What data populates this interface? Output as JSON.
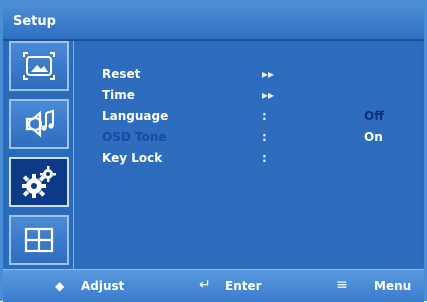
{
  "header": {
    "title": "Setup"
  },
  "sidebar": {
    "tabs": [
      {
        "icon": "picture-icon"
      },
      {
        "icon": "audio-icon"
      },
      {
        "icon": "settings-gears-icon",
        "active": true
      },
      {
        "icon": "layout-grid-icon"
      }
    ]
  },
  "menu": {
    "items": [
      {
        "label": "Reset",
        "separator": "▸▸",
        "value": ""
      },
      {
        "label": "Time",
        "separator": "▸▸",
        "value": ""
      },
      {
        "label": "Language",
        "separator": ":",
        "value": "Off"
      },
      {
        "label": "OSD Tone",
        "separator": ":",
        "value": "On"
      },
      {
        "label": "Key Lock",
        "separator": ":",
        "value": ""
      }
    ],
    "selected_label": "OSD Tone"
  },
  "footer": {
    "adjust_icon": "◆",
    "adjust_label": "Adjust",
    "enter_icon": "↵",
    "enter_label": "Enter",
    "menu_icon": "≡",
    "menu_label": "Menu"
  },
  "colors": {
    "frame": "#4a8fd6",
    "panel": "#2e6dbd",
    "active_tab": "#0c3a86",
    "selected_text": "#1a4aa0"
  }
}
